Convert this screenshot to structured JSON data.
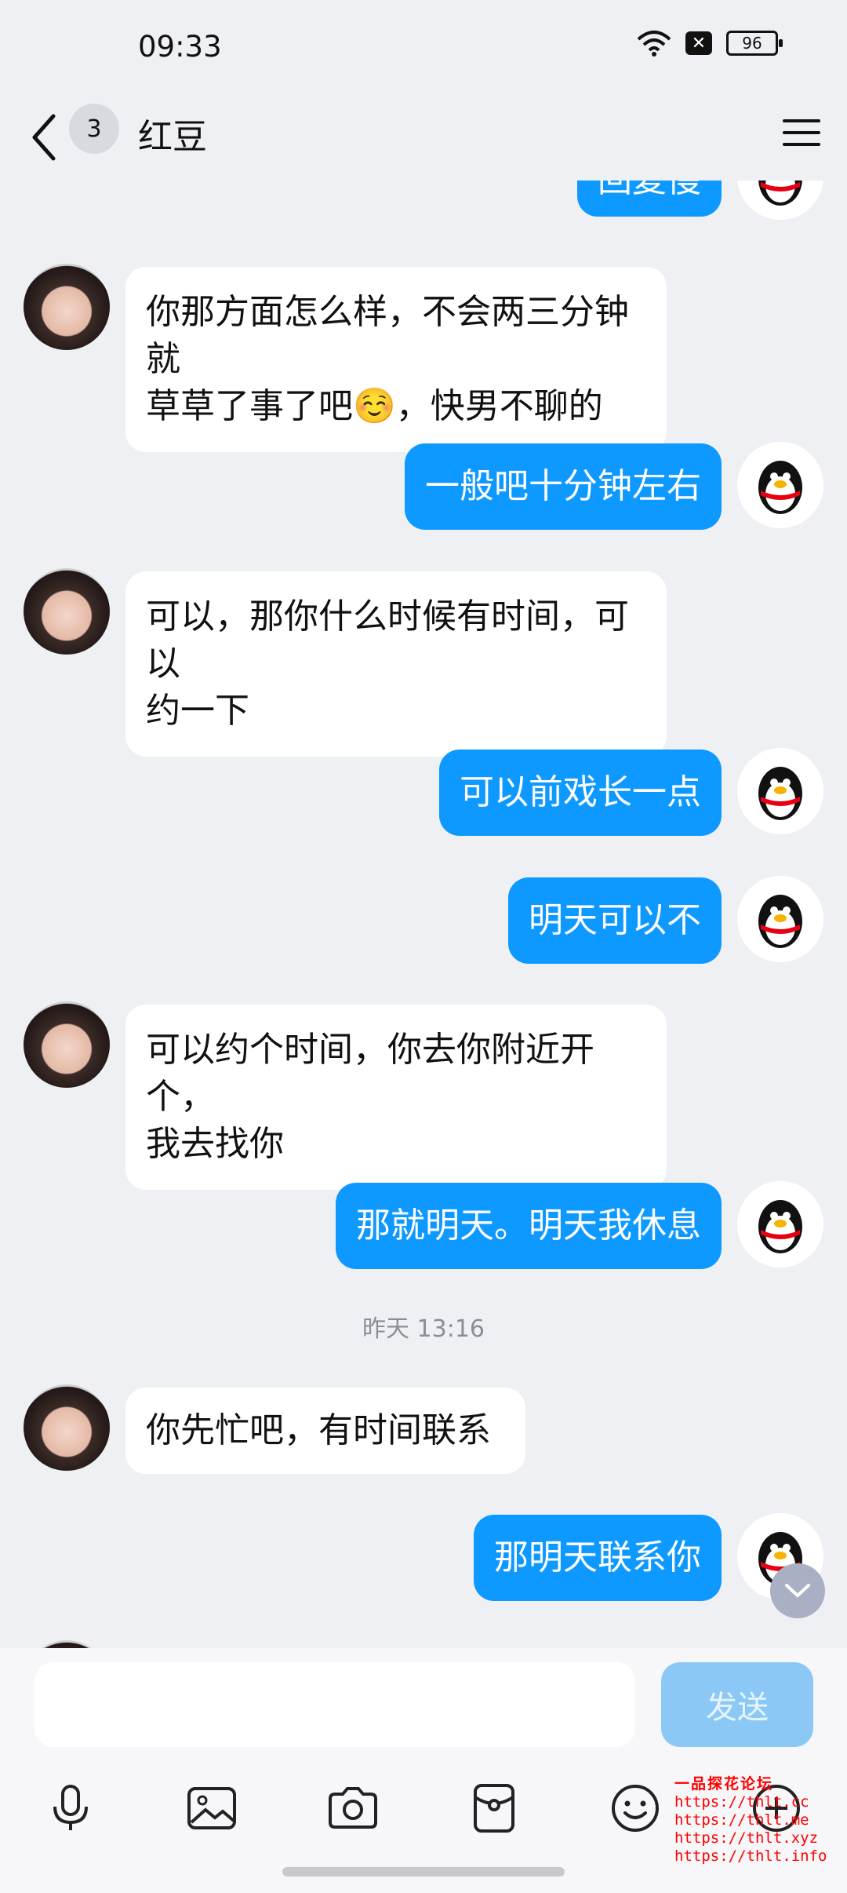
{
  "status_bar": {
    "time": "09:33",
    "battery": "96"
  },
  "header": {
    "unread_count": "3",
    "title": "红豆"
  },
  "messages": [
    {
      "side": "right",
      "text": "回复慢"
    },
    {
      "side": "left",
      "lines": [
        "你那方面怎么样，不会两三分钟就",
        "草草了事了吧☺️，快男不聊的"
      ]
    },
    {
      "side": "right",
      "text": "一般吧十分钟左右"
    },
    {
      "side": "left",
      "lines": [
        "可以，那你什么时候有时间，可以",
        "约一下"
      ]
    },
    {
      "side": "right",
      "text": "可以前戏长一点"
    },
    {
      "side": "right",
      "text": "明天可以不"
    },
    {
      "side": "left",
      "lines": [
        "可以约个时间，你去你附近开个，",
        "我去找你"
      ]
    },
    {
      "side": "right",
      "text": "那就明天。明天我休息"
    },
    {
      "side": "left",
      "lines": [
        "你先忙吧，有时间联系"
      ]
    },
    {
      "side": "right",
      "text": "那明天联系你"
    }
  ],
  "timestamp": "昨天 13:16",
  "composer": {
    "send_label": "发送"
  },
  "toolbar": [
    "mic-icon",
    "image-icon",
    "camera-icon",
    "red-packet-icon",
    "emoji-icon",
    "plus-icon"
  ],
  "watermark": {
    "title": "一品探花论坛",
    "urls": [
      "https://thlt.cc",
      "https://thlt.me",
      "https://thlt.xyz",
      "https://thlt.info"
    ]
  },
  "colors": {
    "bubble_right": "#0d99ff",
    "bubble_left": "#ffffff",
    "background": "#eff0f4",
    "send_disabled": "#8cc8f5"
  }
}
